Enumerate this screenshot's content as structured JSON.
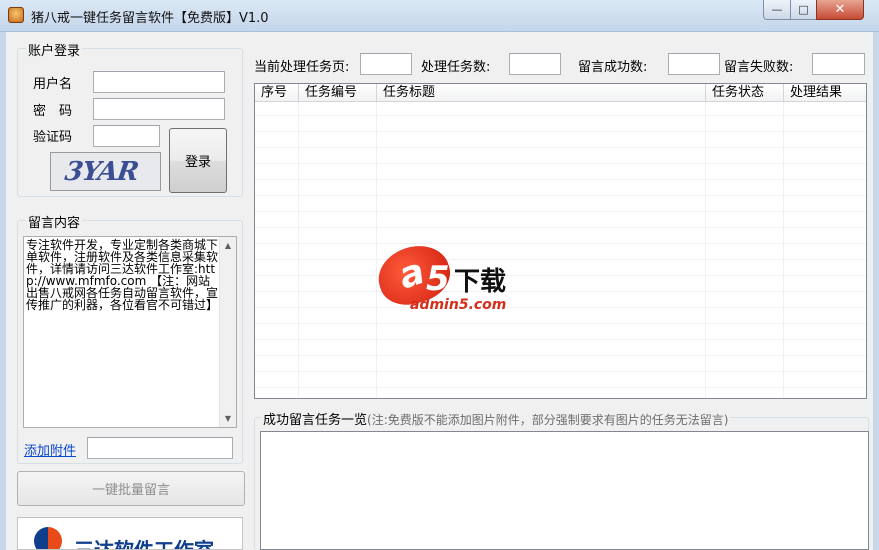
{
  "window": {
    "title": "猪八戒一键任务留言软件【免费版】V1.0",
    "minimize_glyph": "—",
    "maximize_glyph": "□",
    "close_glyph": "✕"
  },
  "login": {
    "group_title": "账户登录",
    "username_label": "用户名",
    "username_value": "",
    "password_label": "密　码",
    "password_value": "",
    "captcha_label": "验证码",
    "captcha_value": "",
    "captcha_image_text": "3YAR",
    "login_button": "登录"
  },
  "message": {
    "group_title": "留言内容",
    "content": "专注软件开发，专业定制各类商城下单软件，注册软件及各类信息采集软件，详情请访问三达软件工作室:http://www.mfmfo.com 【注：网站出售八戒网各任务自动留言软件，宣传推广的利器，各位看官不可错过】",
    "attach_link": "添加附件",
    "attach_value": "",
    "batch_button": "一键批量留言"
  },
  "stats": {
    "current_page_label": "当前处理任务页:",
    "current_page_value": "",
    "task_count_label": "处理任务数:",
    "task_count_value": "",
    "success_label": "留言成功数:",
    "success_value": "",
    "fail_label": "留言失败数:",
    "fail_value": ""
  },
  "task_table": {
    "columns": [
      "序号",
      "任务编号",
      "任务标题",
      "任务状态",
      "处理结果"
    ],
    "rows": []
  },
  "success_panel": {
    "title": "成功留言任务一览",
    "note": "(注:免费版不能添加图片附件，部分强制要求有图片的任务无法留言)"
  },
  "watermark": {
    "letter": "a",
    "digit": "5",
    "text": "下载",
    "domain": "admin5.com"
  },
  "logo": {
    "text": "三达软件工作室"
  }
}
